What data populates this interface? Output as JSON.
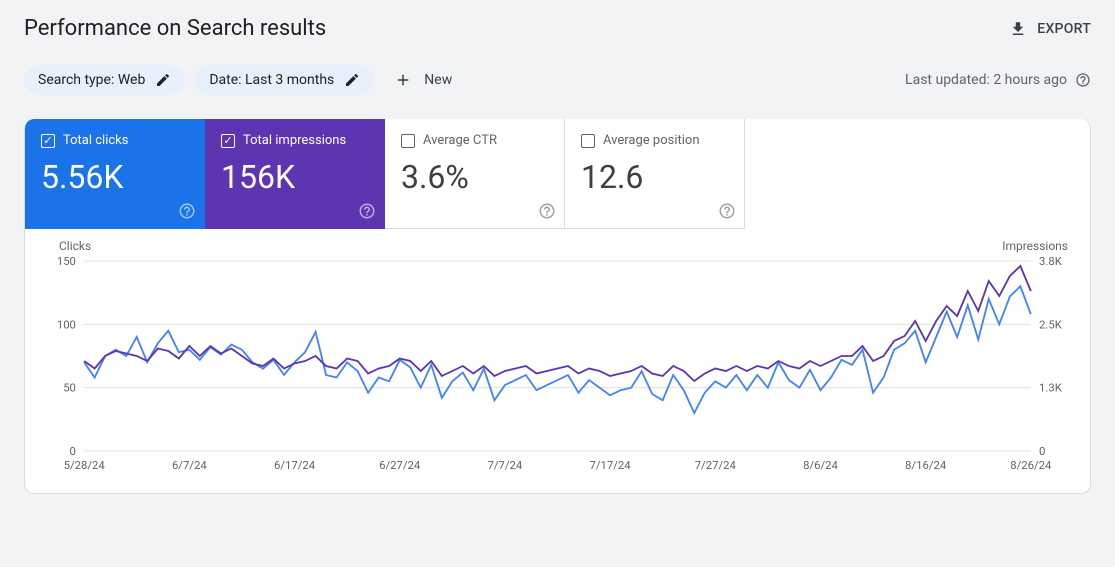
{
  "header": {
    "title": "Performance on Search results",
    "export_label": "EXPORT"
  },
  "filters": {
    "search_type_label": "Search type: Web",
    "date_label": "Date: Last 3 months",
    "new_label": "New"
  },
  "status": {
    "last_updated": "Last updated: 2 hours ago"
  },
  "metrics": {
    "total_clicks": {
      "label": "Total clicks",
      "value": "5.56K"
    },
    "total_impressions": {
      "label": "Total impressions",
      "value": "156K"
    },
    "average_ctr": {
      "label": "Average CTR",
      "value": "3.6%"
    },
    "average_position": {
      "label": "Average position",
      "value": "12.6"
    }
  },
  "chart_data": {
    "type": "line",
    "left_axis_label": "Clicks",
    "right_axis_label": "Impressions",
    "y_left": {
      "ticks": [
        0,
        50,
        100,
        150
      ],
      "min": 0,
      "max": 150
    },
    "y_right": {
      "ticks": [
        "0",
        "1.3K",
        "2.5K",
        "3.8K"
      ],
      "min": 0,
      "max": 3800
    },
    "x_ticks": [
      "5/28/24",
      "6/7/24",
      "6/17/24",
      "6/27/24",
      "7/7/24",
      "7/17/24",
      "7/27/24",
      "8/6/24",
      "8/16/24",
      "8/26/24"
    ],
    "series": [
      {
        "name": "clicks",
        "axis": "left",
        "values": [
          70,
          58,
          75,
          80,
          75,
          90,
          70,
          85,
          95,
          78,
          80,
          72,
          82,
          76,
          84,
          80,
          70,
          65,
          72,
          60,
          70,
          78,
          94,
          60,
          58,
          70,
          63,
          46,
          58,
          55,
          72,
          66,
          50,
          68,
          42,
          55,
          62,
          48,
          65,
          40,
          52,
          56,
          60,
          48,
          52,
          56,
          60,
          46,
          56,
          50,
          44,
          48,
          50,
          63,
          45,
          40,
          60,
          48,
          30,
          46,
          55,
          50,
          60,
          48,
          60,
          50,
          70,
          56,
          50,
          64,
          48,
          58,
          72,
          68,
          80,
          46,
          58,
          80,
          85,
          95,
          70,
          90,
          110,
          90,
          115,
          88,
          120,
          100,
          122,
          130,
          108
        ]
      },
      {
        "name": "impressions",
        "axis": "right",
        "values": [
          1800,
          1650,
          1900,
          2000,
          1950,
          1900,
          1800,
          2050,
          2000,
          1850,
          2100,
          1900,
          2100,
          1950,
          2050,
          1900,
          1750,
          1700,
          1850,
          1650,
          1750,
          1800,
          1900,
          1700,
          1650,
          1850,
          1800,
          1550,
          1650,
          1700,
          1850,
          1800,
          1600,
          1800,
          1500,
          1600,
          1700,
          1550,
          1700,
          1500,
          1600,
          1650,
          1700,
          1550,
          1600,
          1650,
          1700,
          1550,
          1650,
          1600,
          1500,
          1550,
          1600,
          1700,
          1550,
          1500,
          1700,
          1600,
          1400,
          1550,
          1650,
          1600,
          1700,
          1600,
          1700,
          1650,
          1800,
          1700,
          1650,
          1800,
          1700,
          1800,
          1900,
          1900,
          2100,
          1800,
          1900,
          2200,
          2300,
          2600,
          2200,
          2600,
          2900,
          2700,
          3200,
          2800,
          3400,
          3100,
          3500,
          3700,
          3200
        ]
      }
    ]
  }
}
